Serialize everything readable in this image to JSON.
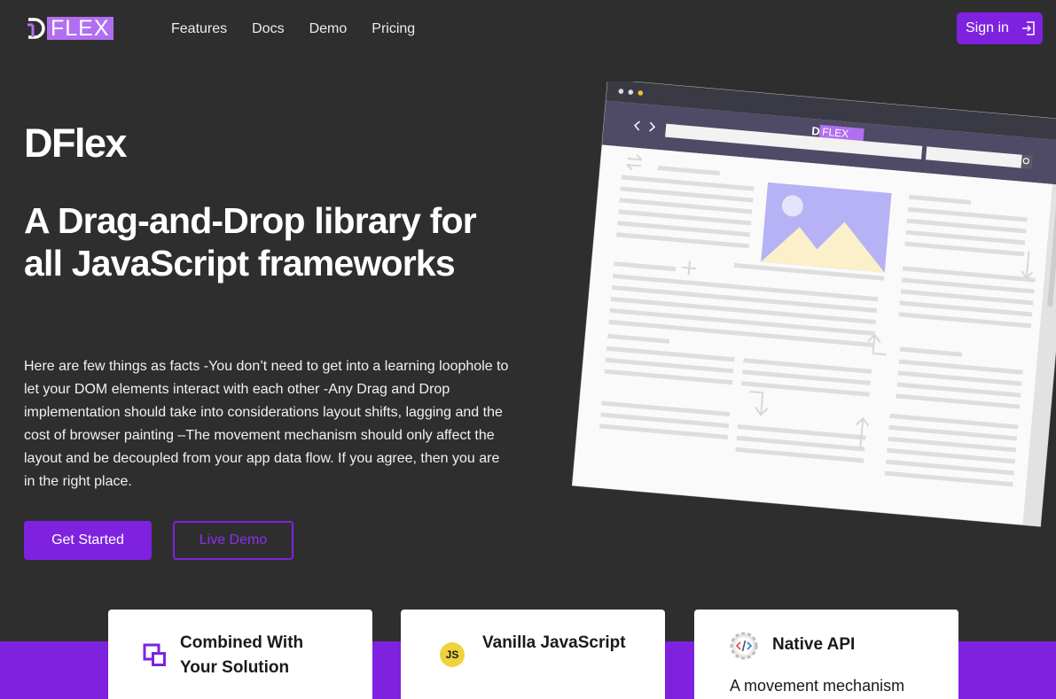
{
  "header": {
    "logo_text": "FLEX",
    "nav": [
      "Features",
      "Docs",
      "Demo",
      "Pricing"
    ],
    "signin_label": "Sign in"
  },
  "hero": {
    "brand": "DFlex",
    "headline": "A Drag-and-Drop library for all JavaScript frameworks",
    "description": "Here are few things as facts -You don’t need to get into a learning loophole to let your DOM elements interact with each other -Any Drag and Drop implementation should take into considerations layout shifts, lagging and the cost of browser painting –The movement mechanism should only affect the layout and be decoupled from your app data flow. If you agree, then you are in the right place.",
    "primary_button": "Get Started",
    "secondary_button": "Live Demo"
  },
  "illustration": {
    "logo_text": "FLEX"
  },
  "features": [
    {
      "title": "Combined With Your Solution",
      "icon": "layers-icon"
    },
    {
      "title": "Vanilla JavaScript",
      "icon": "js-icon",
      "badge": "JS"
    },
    {
      "title": "Native API",
      "icon": "code-gear-icon",
      "text": "A movement mechanism"
    }
  ],
  "colors": {
    "background": "#2f2e2e",
    "accent": "#7e22e0",
    "logo": "#b26ef0"
  }
}
